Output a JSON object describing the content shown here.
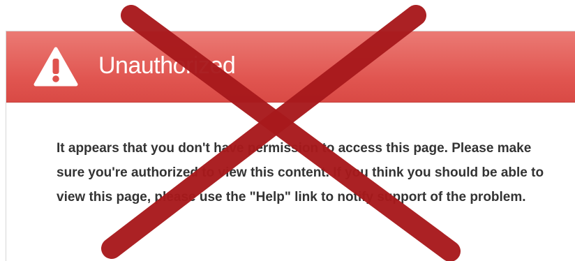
{
  "dialog": {
    "title": "Unauthorized",
    "warning_icon": "warning-triangle-icon",
    "message": "It appears that you don't have permission to access this page. Please make sure you're authorized to view this content. If you think you should be able to view this page, please use the \"Help\" link to notify support of the problem."
  },
  "overlay": {
    "mark": "red-x-cross",
    "color": "#a8191c"
  },
  "colors": {
    "header": "#e0544f",
    "text": "#333333"
  }
}
